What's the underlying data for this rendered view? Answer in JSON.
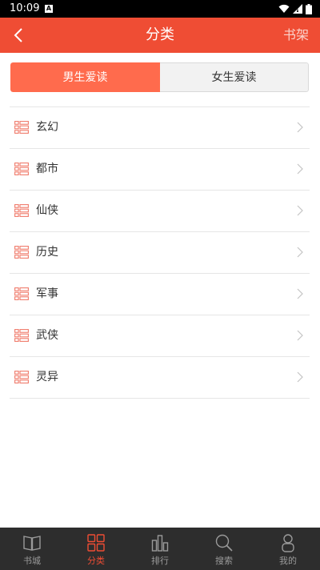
{
  "status_bar": {
    "time": "10:09",
    "notification": "A"
  },
  "header": {
    "title": "分类",
    "right_label": "书架"
  },
  "tabs": [
    {
      "label": "男生爱读",
      "active": true
    },
    {
      "label": "女生爱读",
      "active": false
    }
  ],
  "categories": [
    {
      "label": "玄幻"
    },
    {
      "label": "都市"
    },
    {
      "label": "仙侠"
    },
    {
      "label": "历史"
    },
    {
      "label": "军事"
    },
    {
      "label": "武侠"
    },
    {
      "label": "灵异"
    }
  ],
  "bottom_nav": [
    {
      "label": "书城",
      "icon": "book-icon",
      "active": false
    },
    {
      "label": "分类",
      "icon": "grid-icon",
      "active": true
    },
    {
      "label": "排行",
      "icon": "ranking-icon",
      "active": false
    },
    {
      "label": "搜索",
      "icon": "search-icon",
      "active": false
    },
    {
      "label": "我的",
      "icon": "user-icon",
      "active": false
    }
  ],
  "colors": {
    "accent": "#ef4d34",
    "tab_active": "#ff6b4d",
    "nav_background": "#2d2d2d",
    "category_icon": "#f07a6a"
  }
}
